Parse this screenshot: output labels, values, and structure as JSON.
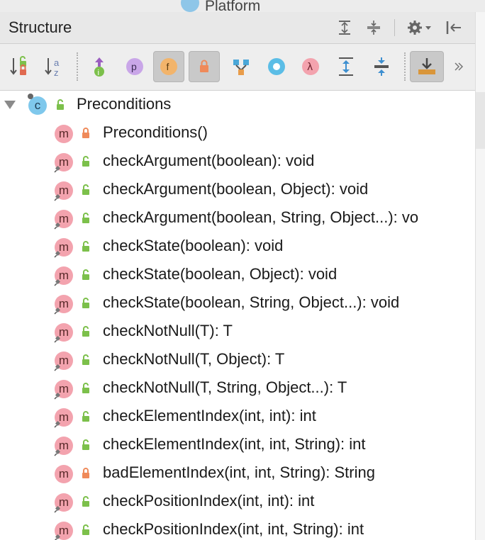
{
  "editor_tab": {
    "label": "Platform"
  },
  "panel": {
    "title": "Structure"
  },
  "title_buttons": {
    "expand_all": "expand-all-icon",
    "collapse_all": "collapse-all-icon",
    "settings": "gear-icon",
    "hide": "hide-panel-icon"
  },
  "toolbar": [
    {
      "name": "sort-by-visibility",
      "icon": "sort-visibility-icon",
      "pressed": false
    },
    {
      "name": "sort-alphabetically",
      "icon": "sort-alpha-icon",
      "pressed": false
    },
    {
      "name": "show-inherited",
      "icon": "inherited-icon",
      "pressed": false
    },
    {
      "name": "show-properties",
      "icon": "properties-icon",
      "glyph": "p",
      "pressed": false
    },
    {
      "name": "show-fields",
      "icon": "fields-icon",
      "glyph": "f",
      "pressed": true
    },
    {
      "name": "show-non-public",
      "icon": "non-public-icon",
      "pressed": true
    },
    {
      "name": "show-hierarchy",
      "icon": "hierarchy-icon",
      "pressed": false
    },
    {
      "name": "show-anonymous",
      "icon": "anonymous-icon",
      "pressed": false
    },
    {
      "name": "show-lambdas",
      "icon": "lambda-icon",
      "glyph": "λ",
      "pressed": false
    },
    {
      "name": "expand-all",
      "icon": "expand-icon",
      "pressed": false
    },
    {
      "name": "collapse-all",
      "icon": "collapse-icon",
      "pressed": false
    },
    {
      "name": "autoscroll-from-source",
      "icon": "autoscroll-icon",
      "pressed": true
    },
    {
      "name": "more",
      "icon": "more-icon",
      "glyph": "»",
      "pressed": false
    }
  ],
  "tree": {
    "root": {
      "label": "Preconditions",
      "kind": "c",
      "visibility": "public"
    },
    "members": [
      {
        "label": "Preconditions()",
        "visibility": "private"
      },
      {
        "label": "checkArgument(boolean): void",
        "visibility": "public"
      },
      {
        "label": "checkArgument(boolean, Object): void",
        "visibility": "public"
      },
      {
        "label": "checkArgument(boolean, String, Object...): vo",
        "visibility": "public"
      },
      {
        "label": "checkState(boolean): void",
        "visibility": "public"
      },
      {
        "label": "checkState(boolean, Object): void",
        "visibility": "public"
      },
      {
        "label": "checkState(boolean, String, Object...): void",
        "visibility": "public"
      },
      {
        "label": "checkNotNull(T): T",
        "visibility": "public"
      },
      {
        "label": "checkNotNull(T, Object): T",
        "visibility": "public"
      },
      {
        "label": "checkNotNull(T, String, Object...): T",
        "visibility": "public"
      },
      {
        "label": "checkElementIndex(int, int): int",
        "visibility": "public"
      },
      {
        "label": "checkElementIndex(int, int, String): int",
        "visibility": "public"
      },
      {
        "label": "badElementIndex(int, int, String): String",
        "visibility": "private"
      },
      {
        "label": "checkPositionIndex(int, int): int",
        "visibility": "public"
      },
      {
        "label": "checkPositionIndex(int, int, String): int",
        "visibility": "public"
      }
    ]
  }
}
